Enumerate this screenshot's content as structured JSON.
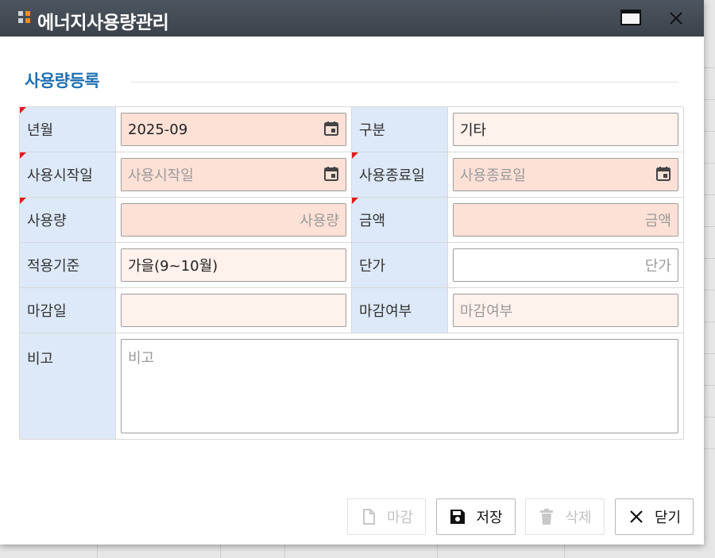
{
  "window": {
    "title": "에너지사용량관리"
  },
  "section": {
    "title": "사용량등록"
  },
  "form": {
    "year_month": {
      "label": "년월",
      "value": "2025-09",
      "placeholder": ""
    },
    "category": {
      "label": "구분",
      "value": "기타",
      "placeholder": ""
    },
    "start_date": {
      "label": "사용시작일",
      "value": "",
      "placeholder": "사용시작일"
    },
    "end_date": {
      "label": "사용종료일",
      "value": "",
      "placeholder": "사용종료일"
    },
    "usage": {
      "label": "사용량",
      "value": "",
      "placeholder": "사용량"
    },
    "amount": {
      "label": "금액",
      "value": "",
      "placeholder": "금액"
    },
    "standard": {
      "label": "적용기준",
      "value": "가을(9~10월)",
      "placeholder": ""
    },
    "unit_price": {
      "label": "단가",
      "value": "",
      "placeholder": "단가"
    },
    "closing_date": {
      "label": "마감일",
      "value": "",
      "placeholder": ""
    },
    "closed_flag": {
      "label": "마감여부",
      "value": "",
      "placeholder": "마감여부"
    },
    "remarks": {
      "label": "비고",
      "value": "",
      "placeholder": "비고"
    }
  },
  "buttons": {
    "close_month": {
      "label": "마감",
      "icon": "document-icon",
      "disabled": true
    },
    "save": {
      "label": "저장",
      "icon": "save-icon",
      "disabled": false
    },
    "delete": {
      "label": "삭제",
      "icon": "trash-icon",
      "disabled": true
    },
    "close": {
      "label": "닫기",
      "icon": "close-icon",
      "disabled": false
    }
  },
  "colors": {
    "title_bar": "#434a53",
    "section_title": "#1f6fb2",
    "label_bg": "#dde9f8",
    "required_input_bg": "#fde1d6",
    "optional_input_bg": "#fff1ec",
    "required_marker": "#e21b1b"
  }
}
